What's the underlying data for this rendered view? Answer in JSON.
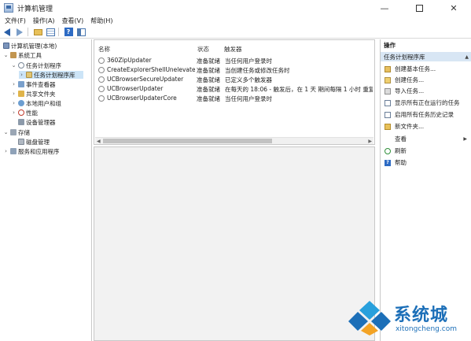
{
  "window": {
    "title": "计算机管理",
    "minimize": "—",
    "close": "✕"
  },
  "menu": [
    "文件(F)",
    "操作(A)",
    "查看(V)",
    "帮助(H)"
  ],
  "tree": {
    "root": "计算机管理(本地)",
    "system_tools": "系统工具",
    "task_scheduler": "任务计划程序",
    "task_library": "任务计划程序库",
    "event_viewer": "事件查看器",
    "shared_folders": "共享文件夹",
    "local_users": "本地用户和组",
    "performance": "性能",
    "device_manager": "设备管理器",
    "storage": "存储",
    "disk_management": "磁盘管理",
    "services": "服务和应用程序"
  },
  "task_list": {
    "columns": [
      "名称",
      "状态",
      "触发器"
    ],
    "rows": [
      {
        "name": "360ZipUpdater",
        "status": "准备就绪",
        "trigger": "当任何用户登录时"
      },
      {
        "name": "CreateExplorerShellUnelevate...",
        "status": "准备就绪",
        "trigger": "当创建任务或修改任务时"
      },
      {
        "name": "UCBrowserSecureUpdater",
        "status": "准备就绪",
        "trigger": "已定义多个触发器"
      },
      {
        "name": "UCBrowserUpdater",
        "status": "准备就绪",
        "trigger": "在每天的 18:06 - 触发后，在 1 天 期间每隔 1 小时 重复一"
      },
      {
        "name": "UCBrowserUpdaterCore",
        "status": "准备就绪",
        "trigger": "当任何用户登录时"
      }
    ]
  },
  "actions": {
    "header": "操作",
    "section": "任务计划程序库",
    "items": [
      {
        "label": "创建基本任务..."
      },
      {
        "label": "创建任务..."
      },
      {
        "label": "导入任务..."
      },
      {
        "label": "显示所有正在运行的任务"
      },
      {
        "label": "启用所有任务历史记录"
      },
      {
        "label": "新文件夹..."
      },
      {
        "label": "查看"
      },
      {
        "label": "刷新"
      },
      {
        "label": "帮助"
      }
    ]
  },
  "watermark": {
    "title": "系统城",
    "url": "xitongcheng.com"
  },
  "colors": {
    "selection": "#cce4f7",
    "section_bg": "#d8e6f4",
    "brand_blue": "#1c6fb8"
  }
}
